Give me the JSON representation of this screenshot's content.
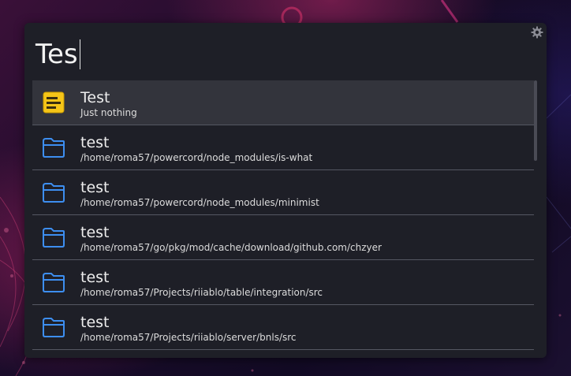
{
  "search": {
    "query": "Tes"
  },
  "results": [
    {
      "title": "Test",
      "subtitle": "Just nothing",
      "icon": "note-icon",
      "selected": true
    },
    {
      "title": "test",
      "subtitle": "/home/roma57/powercord/node_modules/is-what",
      "icon": "folder-icon"
    },
    {
      "title": "test",
      "subtitle": "/home/roma57/powercord/node_modules/minimist",
      "icon": "folder-icon"
    },
    {
      "title": "test",
      "subtitle": "/home/roma57/go/pkg/mod/cache/download/github.com/chzyer",
      "icon": "folder-icon"
    },
    {
      "title": "test",
      "subtitle": "/home/roma57/Projects/riiablo/table/integration/src",
      "icon": "folder-icon"
    },
    {
      "title": "test",
      "subtitle": "/home/roma57/Projects/riiablo/server/bnls/src",
      "icon": "folder-icon"
    }
  ],
  "icons": {
    "settings": "gear-icon"
  },
  "colors": {
    "panel": "#1e1f27",
    "selected_row": "#33343c",
    "folder_blue": "#3d8ef0",
    "note_yellow": "#f5c518"
  }
}
